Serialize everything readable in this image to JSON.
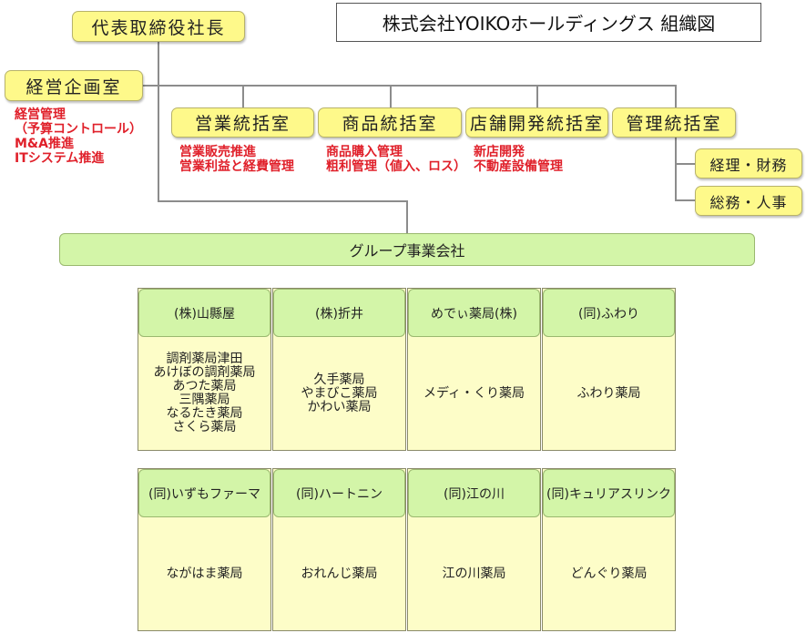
{
  "title": "株式会社YOIKOホールディングス 組織図",
  "ceo": "代表取締役社長",
  "planning_office": {
    "label": "経営企画室",
    "duties": [
      "経営管理",
      "（予算コントロール）",
      "M&A推進",
      "ITシステム推進"
    ]
  },
  "divisions": [
    {
      "label": "営業統括室",
      "duties": [
        "営業販売推進",
        "営業利益と経費管理"
      ]
    },
    {
      "label": "商品統括室",
      "duties": [
        "商品購入管理",
        "粗利管理（値入、ロス）"
      ]
    },
    {
      "label": "店舗開発統括室",
      "duties": [
        "新店開発",
        "不動産設備管理"
      ]
    },
    {
      "label": "管理統括室",
      "duties": []
    }
  ],
  "admin_subunits": [
    "経理・財務",
    "総務・人事"
  ],
  "group_label": "グループ事業会社",
  "companies": [
    {
      "name": "(株)山縣屋",
      "stores": [
        "調剤薬局津田",
        "あけぼの調剤薬局",
        "あつた薬局",
        "三隅薬局",
        "なるたき薬局",
        "さくら薬局"
      ]
    },
    {
      "name": "(株)折井",
      "stores": [
        "久手薬局",
        "やまびこ薬局",
        "かわい薬局"
      ]
    },
    {
      "name": "めでぃ薬局(株)",
      "stores": [
        "メディ・くり薬局"
      ]
    },
    {
      "name": "(同)ふわり",
      "stores": [
        "ふわり薬局"
      ]
    },
    {
      "name": "(同)いずもファーマ",
      "stores": [
        "ながはま薬局"
      ]
    },
    {
      "name": "(同)ハートニン",
      "stores": [
        "おれんじ薬局"
      ]
    },
    {
      "name": "(同)江の川",
      "stores": [
        "江の川薬局"
      ]
    },
    {
      "name": "(同)キュリアスリンク",
      "stores": [
        "どんぐり薬局"
      ]
    }
  ]
}
